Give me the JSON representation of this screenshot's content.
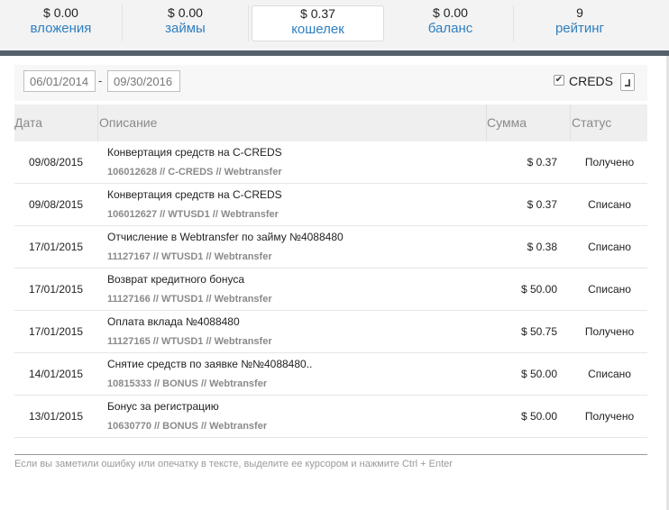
{
  "stats": [
    {
      "value": "$ 0.00",
      "label": "вложения"
    },
    {
      "value": "$ 0.00",
      "label": "займы"
    },
    {
      "value": "$ 0.37",
      "label": "кошелек"
    },
    {
      "value": "$ 0.00",
      "label": "баланс"
    },
    {
      "value": "9",
      "label": "рейтинг"
    }
  ],
  "filter": {
    "date_from": "06/01/2014",
    "date_to": "09/30/2016",
    "dash": "-",
    "checkbox_label": "CREDS",
    "checkbox_checked": true
  },
  "table": {
    "headers": {
      "date": "Дата",
      "description": "Описание",
      "sum": "Сумма",
      "status": "Статус"
    },
    "rows": [
      {
        "date": "09/08/2015",
        "title": "Конвертация средств на C-CREDS",
        "sub": "106012628 // C-CREDS // Webtransfer",
        "sum": "$ 0.37",
        "status": "Получено"
      },
      {
        "date": "09/08/2015",
        "title": "Конвертация средств на C-CREDS",
        "sub": "106012627 // WTUSD1 // Webtransfer",
        "sum": "$ 0.37",
        "status": "Списано"
      },
      {
        "date": "17/01/2015",
        "title": "Отчисление в Webtransfer по займу №4088480",
        "sub": "11127167 // WTUSD1 // Webtransfer",
        "sum": "$ 0.38",
        "status": "Списано"
      },
      {
        "date": "17/01/2015",
        "title": "Возврат кредитного бонуса",
        "sub": "11127166 // WTUSD1 // Webtransfer",
        "sum": "$ 50.00",
        "status": "Списано"
      },
      {
        "date": "17/01/2015",
        "title": "Оплата вклада №4088480",
        "sub": "11127165 // WTUSD1 // Webtransfer",
        "sum": "$ 50.75",
        "status": "Получено"
      },
      {
        "date": "14/01/2015",
        "title": "Снятие средств по заявке №№4088480..",
        "sub": "10815333 // BONUS // Webtransfer",
        "sum": "$ 50.00",
        "status": "Списано"
      },
      {
        "date": "13/01/2015",
        "title": "Бонус за регистрацию",
        "sub": "10630770 // BONUS // Webtransfer",
        "sum": "$ 50.00",
        "status": "Получено"
      }
    ]
  },
  "footer_note": "Если вы заметили ошибку или опечатку в тексте, выделите ее курсором и нажмите Ctrl + Enter"
}
